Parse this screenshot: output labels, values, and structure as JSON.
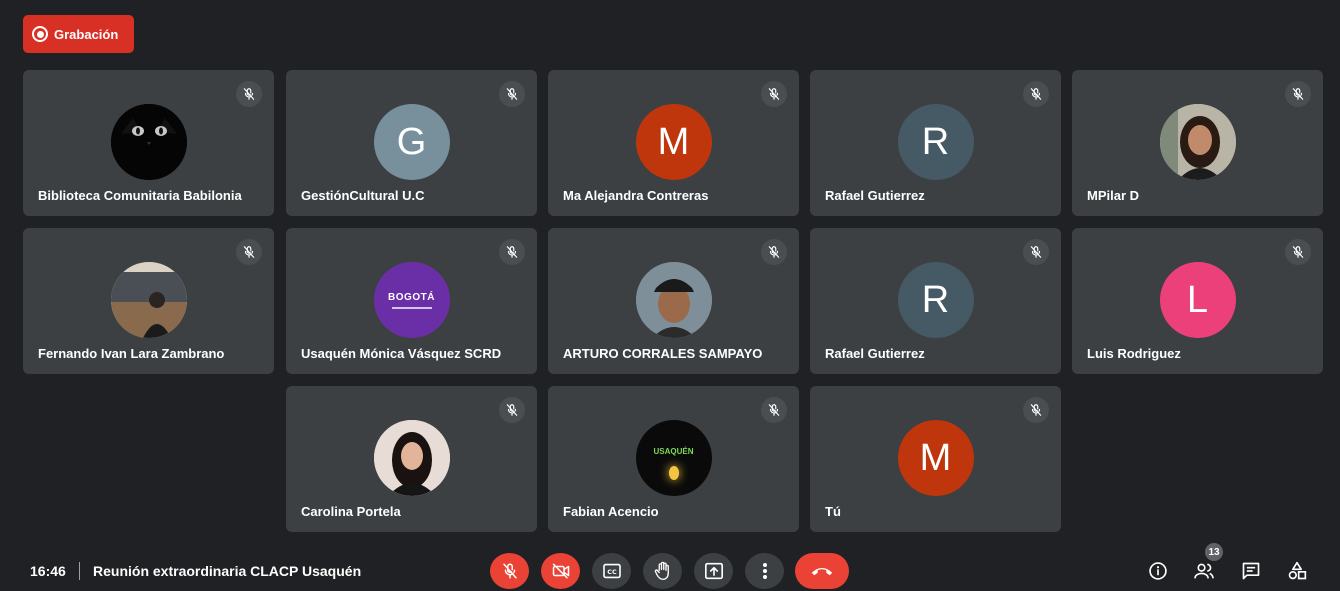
{
  "recording": {
    "label": "Grabación"
  },
  "participants": [
    {
      "name": "Biblioteca Comunitaria Babilonia",
      "avatar": "black-cat-photo"
    },
    {
      "name": "GestiónCultural U.C",
      "initial": "G",
      "color": "#78909c"
    },
    {
      "name": "Ma Alejandra Contreras",
      "initial": "M",
      "color": "#bf360c"
    },
    {
      "name": "Rafael Gutierrez",
      "initial": "R",
      "color": "#455a64"
    },
    {
      "name": "MPilar D",
      "avatar": "woman-photo"
    },
    {
      "name": "Fernando Ivan Lara Zambrano",
      "avatar": "man-auditorium-photo"
    },
    {
      "name": "Usaquén Mónica Vásquez SCRD",
      "avatar": "bogota-logo",
      "logo_text": "BOGOTÁ"
    },
    {
      "name": "ARTURO CORRALES SAMPAYO",
      "avatar": "man-cap-photo"
    },
    {
      "name": "Rafael Gutierrez",
      "initial": "R",
      "color": "#455a64"
    },
    {
      "name": "Luis Rodriguez",
      "initial": "L",
      "color": "#ec407a"
    },
    {
      "name": "Carolina Portela",
      "avatar": "woman-dark-hair-photo"
    },
    {
      "name": "Fabian Acencio",
      "avatar": "usaquen-poster",
      "poster_text": "USAQUÉN"
    },
    {
      "name": "Tú",
      "initial": "M",
      "color": "#bf360c"
    }
  ],
  "footer": {
    "time": "16:46",
    "meeting_title": "Reunión extraordinaria CLACP Usaquén",
    "controls": [
      "mic-off-icon",
      "camera-off-icon",
      "captions-icon",
      "raise-hand-icon",
      "present-icon",
      "more-icon",
      "hang-up-icon"
    ],
    "people_count": "13",
    "right_icons": [
      "info-icon",
      "people-icon",
      "chat-icon",
      "activities-icon"
    ]
  },
  "colors": {
    "background": "#202124",
    "tile": "#3c4043",
    "red": "#ea4335",
    "recording": "#d93025"
  }
}
